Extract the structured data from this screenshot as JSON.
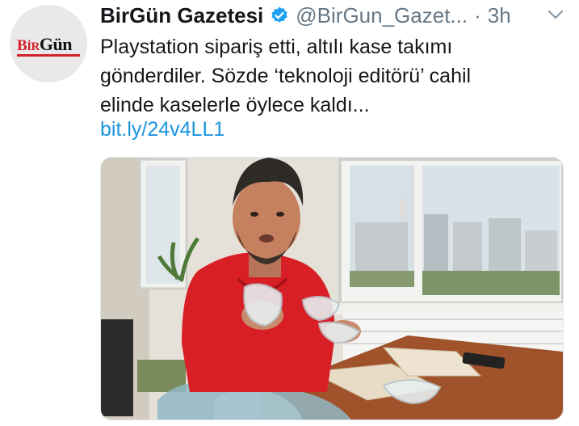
{
  "tweet": {
    "author": {
      "display_name": "BirGün Gazetesi",
      "handle": "@BirGun_Gazet...",
      "avatar_logo_text": "BirGün",
      "verified_icon": "verified-badge-icon"
    },
    "separator": "·",
    "timestamp": "3h",
    "menu_icon": "chevron-down-icon",
    "text_lines": [
      "Playstation sipariş etti, altılı kase takımı",
      "gönderdiler. Sözde ‘teknoloji editörü’ cahil",
      "elinde kaselerle öylece kaldı..."
    ],
    "link": "bit.ly/24v4LL1",
    "media": {
      "type": "photo"
    }
  },
  "colors": {
    "name": "#14171a",
    "secondary": "#657786",
    "link": "#1b95e0",
    "verified": "#1da1f2",
    "logo_red": "#d6212b"
  }
}
